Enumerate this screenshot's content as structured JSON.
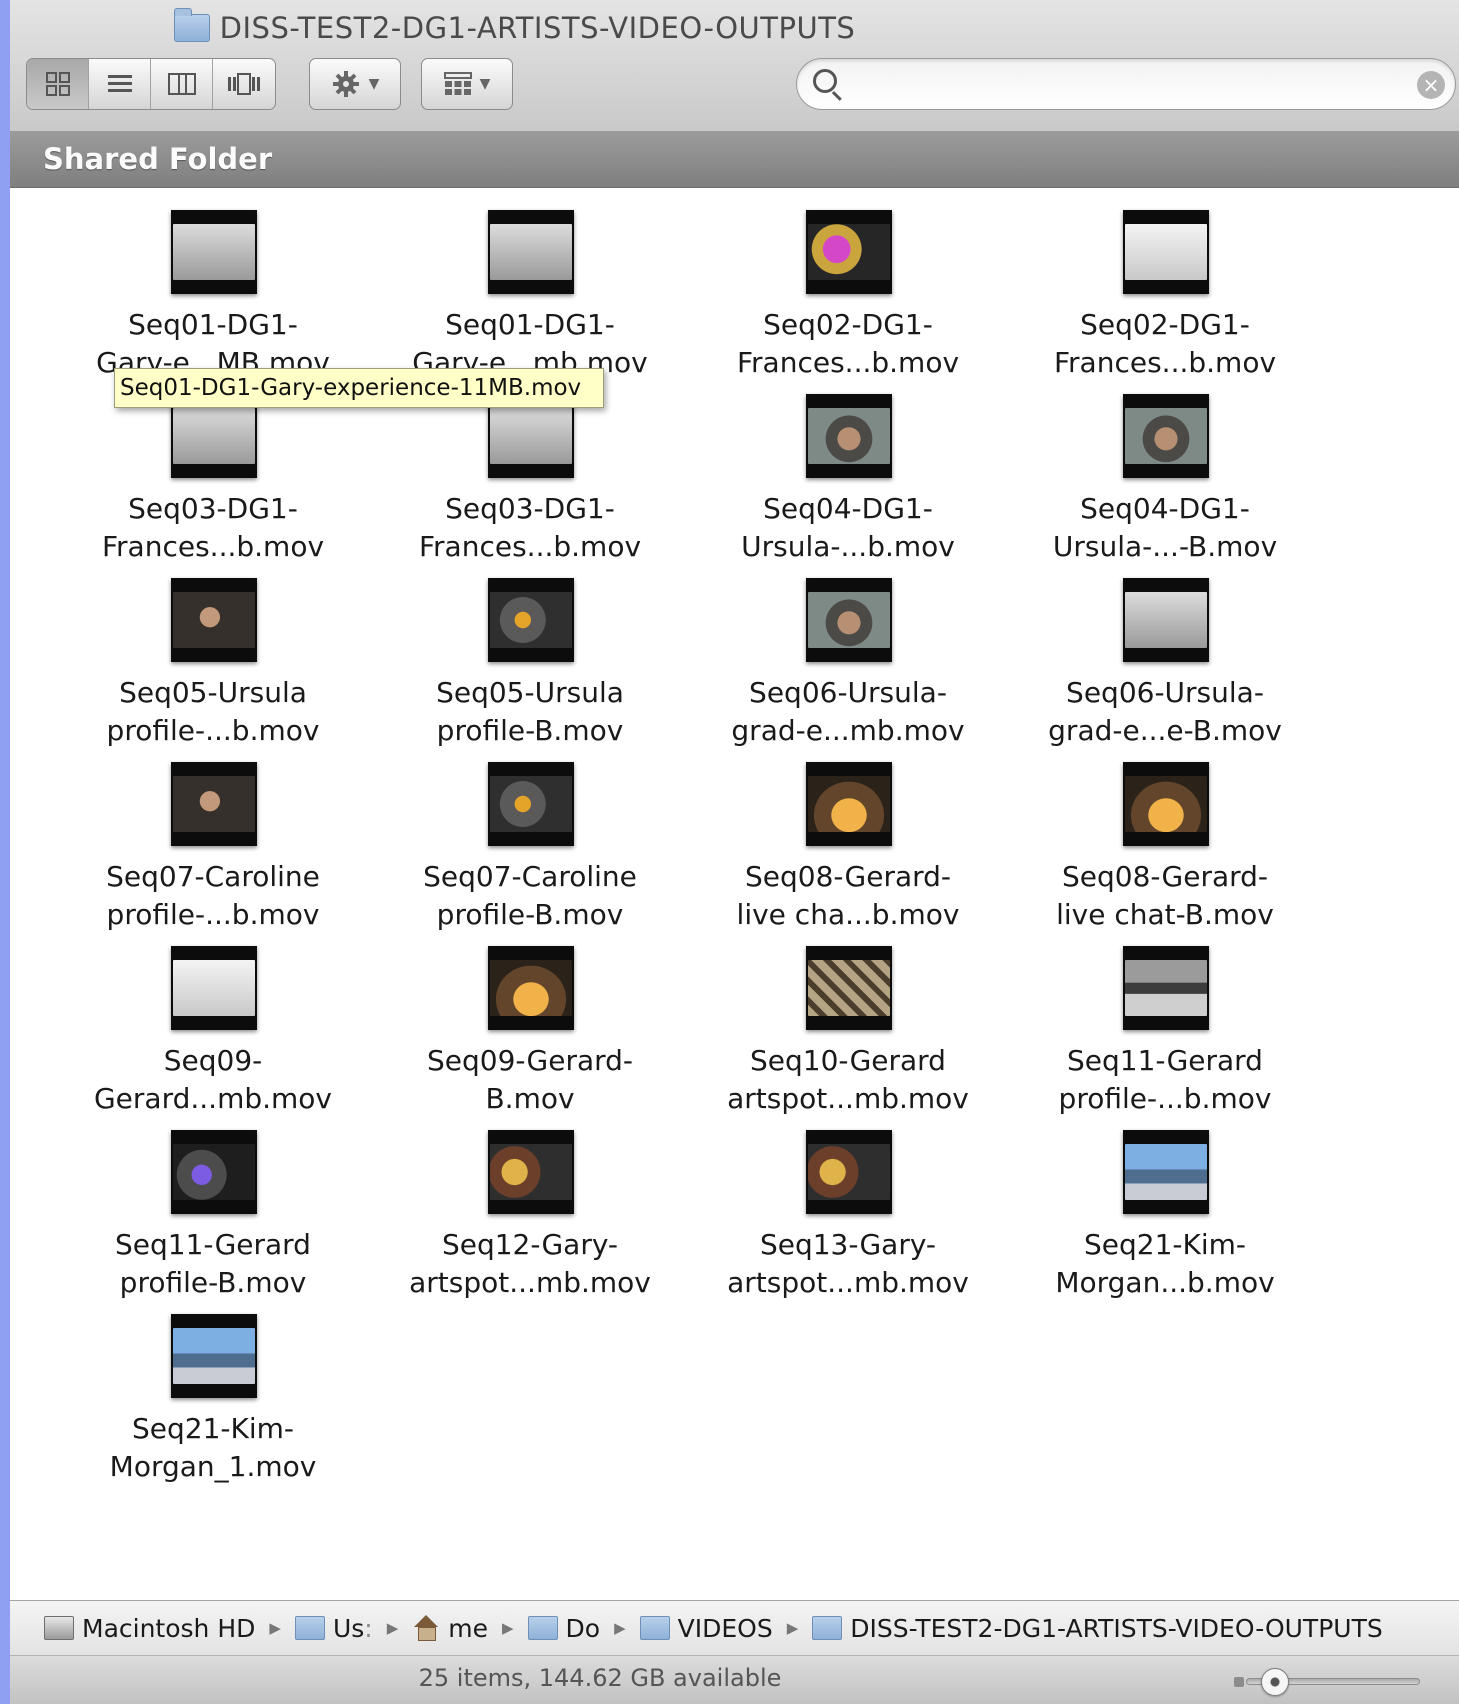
{
  "window": {
    "title": "DISS-TEST2-DG1-ARTISTS-VIDEO-OUTPUTS"
  },
  "toolbar": {
    "view_buttons": [
      "icon-view",
      "list-view",
      "column-view",
      "cover-flow-view"
    ],
    "active_view": "icon-view",
    "action_icon": "gear-icon",
    "arrange_icon": "arrange-icon"
  },
  "search": {
    "value": "",
    "placeholder": ""
  },
  "header": {
    "label": "Shared Folder"
  },
  "files": [
    {
      "line1": "Seq01-DG1-",
      "line2": "Gary-e...MB.mov",
      "thumb": "grey"
    },
    {
      "line1": "Seq01-DG1-",
      "line2": "Gary-e...mb.mov",
      "thumb": "grey"
    },
    {
      "line1": "Seq02-DG1-",
      "line2": "Frances...b.mov",
      "thumb": "purple"
    },
    {
      "line1": "Seq02-DG1-",
      "line2": "Frances...b.mov",
      "thumb": "paper"
    },
    {
      "line1": "Seq03-DG1-",
      "line2": "Frances...b.mov",
      "thumb": "grey"
    },
    {
      "line1": "Seq03-DG1-",
      "line2": "Frances...b.mov",
      "thumb": "grey"
    },
    {
      "line1": "Seq04-DG1-",
      "line2": "Ursula-...b.mov",
      "thumb": "face"
    },
    {
      "line1": "Seq04-DG1-",
      "line2": "Ursula-...-B.mov",
      "thumb": "face"
    },
    {
      "line1": "Seq05-Ursula",
      "line2": "profile-...b.mov",
      "thumb": "dark"
    },
    {
      "line1": "Seq05-Ursula",
      "line2": "profile-B.mov",
      "thumb": "amber"
    },
    {
      "line1": "Seq06-Ursula-",
      "line2": "grad-e...mb.mov",
      "thumb": "face"
    },
    {
      "line1": "Seq06-Ursula-",
      "line2": "grad-e...e-B.mov",
      "thumb": "grey"
    },
    {
      "line1": "Seq07-Caroline",
      "line2": "profile-...b.mov",
      "thumb": "dark"
    },
    {
      "line1": "Seq07-Caroline",
      "line2": "profile-B.mov",
      "thumb": "amber"
    },
    {
      "line1": "Seq08-Gerard-",
      "line2": "live cha...b.mov",
      "thumb": "table"
    },
    {
      "line1": "Seq08-Gerard-",
      "line2": "live chat-B.mov",
      "thumb": "table"
    },
    {
      "line1": "Seq09-",
      "line2": "Gerard...mb.mov",
      "thumb": "paper"
    },
    {
      "line1": "Seq09-Gerard-",
      "line2": "B.mov",
      "thumb": "table"
    },
    {
      "line1": "Seq10-Gerard",
      "line2": "artspot...mb.mov",
      "thumb": "grid"
    },
    {
      "line1": "Seq11-Gerard",
      "line2": "profile-...b.mov",
      "thumb": "land"
    },
    {
      "line1": "Seq11-Gerard",
      "line2": "profile-B.mov",
      "thumb": "violet"
    },
    {
      "line1": "Seq12-Gary-",
      "line2": "artspot...mb.mov",
      "thumb": "crowd"
    },
    {
      "line1": "Seq13-Gary-",
      "line2": "artspot...mb.mov",
      "thumb": "crowd"
    },
    {
      "line1": "Seq21-Kim-",
      "line2": "Morgan...b.mov",
      "thumb": "blue"
    },
    {
      "line1": "Seq21-Kim-",
      "line2": "Morgan_1.mov",
      "thumb": "blue"
    }
  ],
  "tooltip": {
    "text": "Seq01-DG1-Gary-experience-11MB.mov"
  },
  "pathbar": {
    "items": [
      {
        "label": "Macintosh HD",
        "icon": "hard-drive-icon"
      },
      {
        "label": "Us",
        "icon": "folder-icon"
      },
      {
        "label": "me",
        "icon": "home-icon"
      },
      {
        "label": "Do",
        "icon": "folder-icon"
      },
      {
        "label": "VIDEOS",
        "icon": "folder-icon"
      },
      {
        "label": "DISS-TEST2-DG1-ARTISTS-VIDEO-OUTPUTS",
        "icon": "folder-icon"
      }
    ]
  },
  "status": {
    "text": "25 items, 144.62 GB available"
  },
  "icon_size_slider": {
    "level": 0.1
  }
}
